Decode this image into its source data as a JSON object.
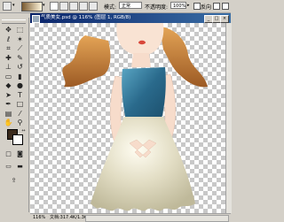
{
  "options_bar": {
    "mode_label": "模式:",
    "mode_value": "正常",
    "opacity_label": "不透明度:",
    "opacity_value": "100%",
    "reverse_label": "反向",
    "gradient_preview_colors": [
      "#7a5a30",
      "#fff6dc"
    ]
  },
  "document": {
    "title": "气质美女.psd @ 116% (图层 1, RGB/8)",
    "zoom": "116%",
    "status_zoom": "116%",
    "status_info": "文档:317.4K/1.36M"
  },
  "toolbox": {
    "tools": [
      {
        "name": "move-tool",
        "glyph": "✥"
      },
      {
        "name": "marquee-tool",
        "glyph": "⬚"
      },
      {
        "name": "lasso-tool",
        "glyph": "ℓ"
      },
      {
        "name": "magic-wand-tool",
        "glyph": "✶"
      },
      {
        "name": "crop-tool",
        "glyph": "⌗"
      },
      {
        "name": "slice-tool",
        "glyph": "⟋"
      },
      {
        "name": "healing-brush-tool",
        "glyph": "✚"
      },
      {
        "name": "brush-tool",
        "glyph": "✎"
      },
      {
        "name": "clone-stamp-tool",
        "glyph": "⊥"
      },
      {
        "name": "history-brush-tool",
        "glyph": "↺"
      },
      {
        "name": "eraser-tool",
        "glyph": "▭"
      },
      {
        "name": "gradient-tool",
        "glyph": "▮"
      },
      {
        "name": "blur-tool",
        "glyph": "◆"
      },
      {
        "name": "dodge-tool",
        "glyph": "●"
      },
      {
        "name": "path-selection-tool",
        "glyph": "➤"
      },
      {
        "name": "type-tool",
        "glyph": "T"
      },
      {
        "name": "pen-tool",
        "glyph": "✒"
      },
      {
        "name": "shape-tool",
        "glyph": "□"
      },
      {
        "name": "notes-tool",
        "glyph": "▤"
      },
      {
        "name": "eyedropper-tool",
        "glyph": "⁄"
      },
      {
        "name": "hand-tool",
        "glyph": "✋"
      },
      {
        "name": "zoom-tool",
        "glyph": "⚲"
      }
    ],
    "foreground_color": "#3a2a1c",
    "background_color": "#ffffff"
  },
  "colors": {
    "title_bar": "#0a246a",
    "hair": "#c8843c",
    "skin": "#f7dccb",
    "top": "#2a6a8c",
    "skirt": "#d7d3b8",
    "background": "#d4d0c8"
  }
}
